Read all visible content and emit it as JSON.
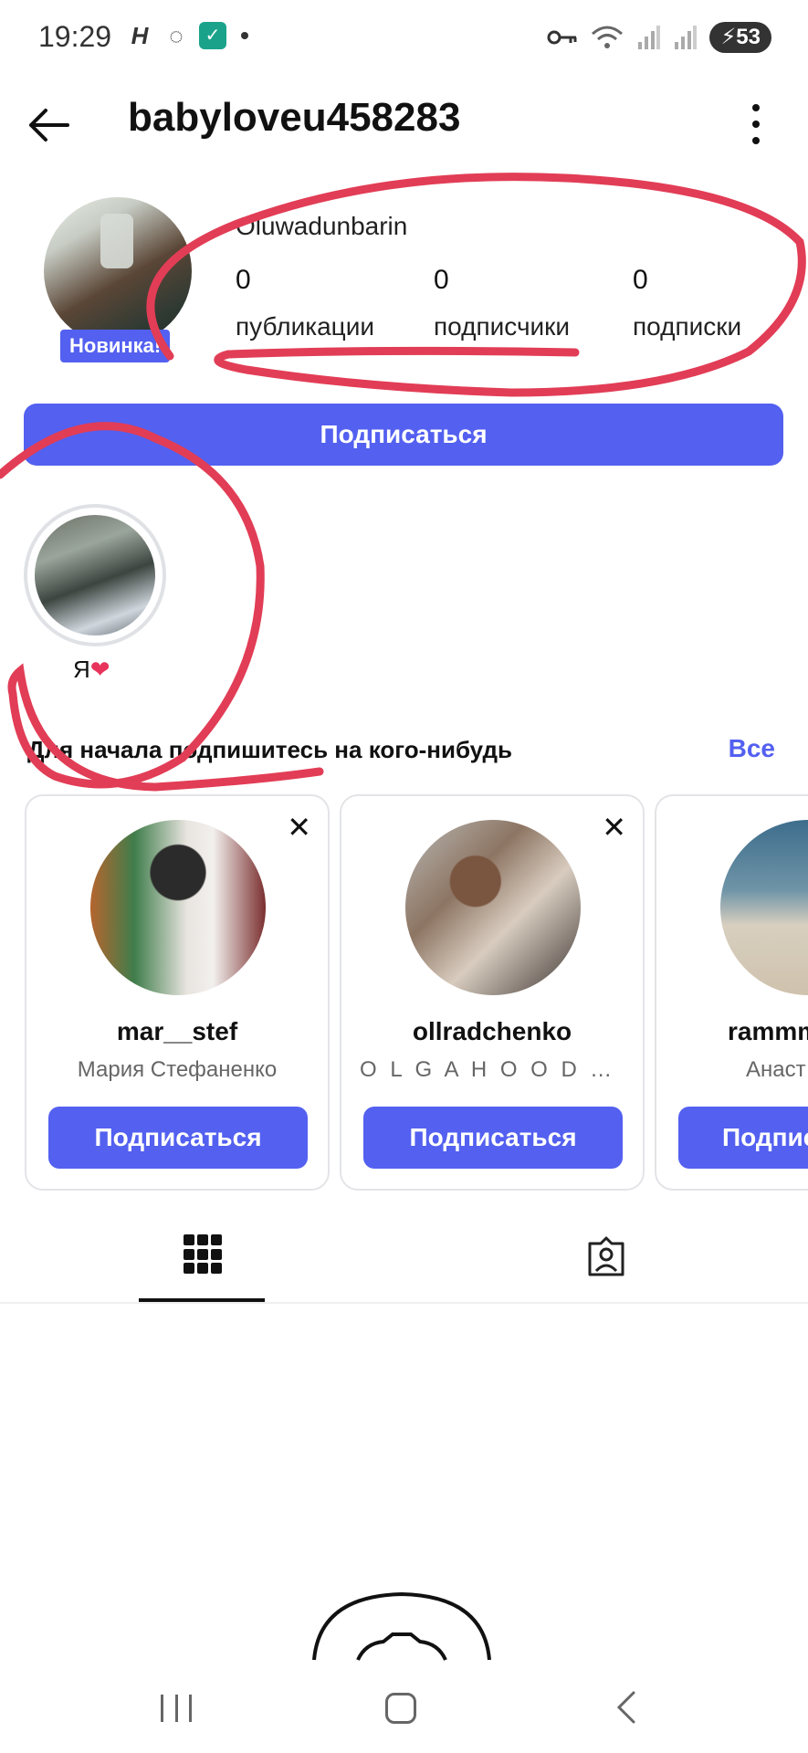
{
  "status_bar": {
    "time": "19:29",
    "battery": "53",
    "left_icons": [
      "h-app-icon",
      "chat-bubble-icon",
      "green-check-app-icon"
    ],
    "right_icons": [
      "vpn-key-icon",
      "wifi-icon",
      "signal-icon",
      "signal-icon",
      "battery-icon"
    ]
  },
  "header": {
    "username": "babyloveu458283"
  },
  "profile": {
    "display_name": "Oluwadunbarin",
    "new_badge": "Новинка!",
    "stats": [
      {
        "value": "0",
        "label": "публикации"
      },
      {
        "value": "0",
        "label": "подписчики"
      },
      {
        "value": "0",
        "label": "подписки"
      }
    ],
    "follow_button": "Подписаться"
  },
  "highlight": {
    "label": "Я",
    "emoji": "❤"
  },
  "suggestions": {
    "title": "Для начала подпишитесь на кого-нибудь",
    "see_all": "Все",
    "cards": [
      {
        "username": "mar__stef",
        "full_name": "Мария Стефаненко",
        "button": "Подписаться"
      },
      {
        "username": "ollradchenko",
        "full_name": "O L G A  H O O D Y A…",
        "button": "Подписаться"
      },
      {
        "username": "rammm",
        "full_name": "Анаст",
        "button": "Подпис"
      }
    ]
  },
  "colors": {
    "accent": "#5360f0",
    "annotation": "#e23d56"
  }
}
